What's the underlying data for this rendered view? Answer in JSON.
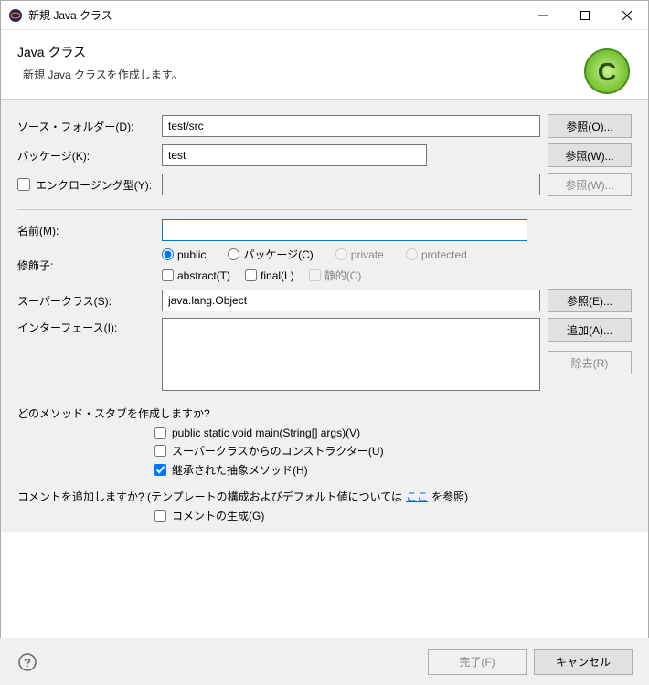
{
  "window": {
    "title": "新規 Java クラス"
  },
  "header": {
    "title": "Java クラス",
    "subtitle": "新規 Java クラスを作成します。"
  },
  "labels": {
    "source_folder": "ソース・フォルダー(D):",
    "package": "パッケージ(K):",
    "enclosing": "エンクロージング型(Y):",
    "name": "名前(M):",
    "modifiers": "修飾子:",
    "superclass": "スーパークラス(S):",
    "interfaces": "インターフェース(I):",
    "stubs_q": "どのメソッド・スタブを作成しますか?",
    "comments_q": "コメントを追加しますか? (テンプレートの構成およびデフォルト値については",
    "comments_link": "ここ",
    "comments_suffix": "を参照)"
  },
  "fields": {
    "source_folder": "test/src",
    "package": "test",
    "enclosing": "",
    "name": "",
    "superclass": "java.lang.Object"
  },
  "buttons": {
    "browse_o": "参照(O)...",
    "browse_w": "参照(W)...",
    "browse_w2": "参照(W)...",
    "browse_e": "参照(E)...",
    "add_a": "追加(A)...",
    "remove_r": "除去(R)",
    "finish": "完了(F)",
    "cancel": "キャンセル"
  },
  "modifiers": {
    "public": "public",
    "package": "パッケージ(C)",
    "private": "private",
    "protected": "protected",
    "abstract": "abstract(T)",
    "final": "final(L)",
    "static": "静的(C)"
  },
  "stubs": {
    "main": "public static void main(String[] args)(V)",
    "super_constructors": "スーパークラスからのコンストラクター(U)",
    "inherited_abstract": "継承された抽象メソッド(H)"
  },
  "comments": {
    "generate": "コメントの生成(G)"
  }
}
